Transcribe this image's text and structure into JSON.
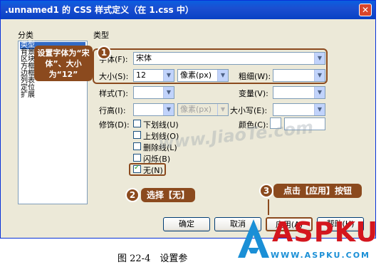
{
  "window": {
    "title": ".unnamed1 的 CSS 样式定义（在 1.css 中）",
    "close_glyph": "✕"
  },
  "category": {
    "header": "分类",
    "items": [
      "类型",
      "背景",
      "区块",
      "方框",
      "边框",
      "列表",
      "定位",
      "扩展"
    ],
    "selected_index": 0
  },
  "panel": {
    "header": "类型",
    "font_label": "字体(F):",
    "font_value": "宋体",
    "size_label": "大小(S):",
    "size_value": "12",
    "size_unit": "像素(px)",
    "weight_label": "粗细(W):",
    "weight_value": "",
    "style_label": "样式(T):",
    "style_value": "",
    "variant_label": "变量(V):",
    "variant_value": "",
    "lineheight_label": "行高(I):",
    "lineheight_value": "",
    "lineheight_unit": "像素(px)",
    "case_label": "大小写(E):",
    "case_value": "",
    "decoration_label": "修饰(D):",
    "color_label": "颜色(C):",
    "color_value": "",
    "decorations": [
      {
        "label": "下划线(U)",
        "checked": false
      },
      {
        "label": "上划线(O)",
        "checked": false
      },
      {
        "label": "删除线(L)",
        "checked": false
      },
      {
        "label": "闪烁(B)",
        "checked": false
      },
      {
        "label": "无(N)",
        "checked": true
      }
    ]
  },
  "buttons": {
    "ok": "确定",
    "cancel": "取消",
    "apply": "应用(A)",
    "help": "帮助(H)"
  },
  "annotations": {
    "step1_num": "1",
    "step1_text": "设置字体为“宋体”、大小为“12”",
    "step2_num": "2",
    "step2_text": "选择【无】",
    "step3_num": "3",
    "step3_text": "点击【应用】按钮"
  },
  "caption": "图 22-4　设置参",
  "watermark": "www.JiaoTe.com",
  "logo": {
    "text": "ASPKU",
    "domain": "WWW.ASPKU.COM",
    "color": "#d4161e",
    "accent": "#1a8fd6"
  },
  "colors": {
    "annotation": "#8b4a1e",
    "titlebar": "#0a5fe0",
    "selection": "#316ac5"
  }
}
